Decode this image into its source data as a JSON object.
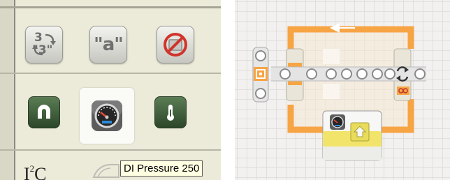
{
  "palette": {
    "left_background": "#ecead9",
    "canvas_background": "#f2f1f0",
    "loop_orange": "#f7a544",
    "sensor_yellow": "#f2e46a",
    "tooltip_background": "#ffffe1",
    "green_block": "#3f5e3a"
  },
  "palette_panel": {
    "row1_buttons": [
      {
        "name": "number-to-text",
        "icon": "number-to-text-icon",
        "top": "3",
        "bottom": "\"3\""
      },
      {
        "name": "text",
        "icon": "text-icon",
        "label": "\"a\""
      },
      {
        "name": "disabled",
        "icon": "no-entry-icon"
      }
    ],
    "row2_buttons": [
      {
        "name": "magnet-sensor",
        "icon": "magnet-icon"
      },
      {
        "name": "pressure-sensor",
        "icon": "pressure-gauge-icon",
        "selected": true
      },
      {
        "name": "temperature-sensor",
        "icon": "thermometer-icon"
      }
    ],
    "section_label": "I",
    "section_label_sup": "2",
    "section_label_rest": "C",
    "tooltip": "DI Pressure 250"
  },
  "program_canvas": {
    "blocks": [
      {
        "name": "start-block",
        "icon": "start-icon"
      },
      {
        "name": "loop-block",
        "icon": "loop-icon",
        "mode_icon": "infinity-icon"
      },
      {
        "name": "pressure-sensor-block",
        "icon": "pressure-gauge-icon",
        "output_icon": "upload-arrow-icon"
      }
    ]
  }
}
